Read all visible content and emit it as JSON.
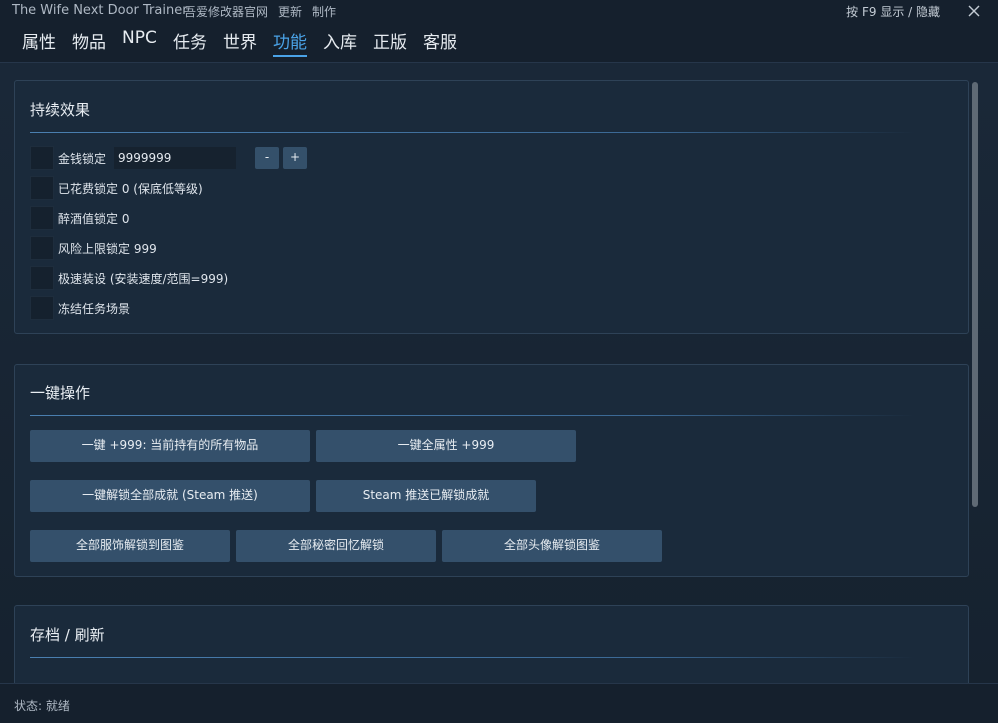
{
  "window": {
    "title": "The Wife Next Door Trainer",
    "links": [
      "吾爱修改器官网",
      "更新",
      "制作"
    ],
    "hint": "按 F9 显示 / 隐藏"
  },
  "tabs": [
    {
      "label": "属性",
      "active": false
    },
    {
      "label": "物品",
      "active": false
    },
    {
      "label": "NPC",
      "active": false
    },
    {
      "label": "任务",
      "active": false
    },
    {
      "label": "世界",
      "active": false
    },
    {
      "label": "功能",
      "active": true
    },
    {
      "label": "入库",
      "active": false
    },
    {
      "label": "正版",
      "active": false
    },
    {
      "label": "客服",
      "active": false
    }
  ],
  "sections": {
    "persistent": {
      "title": "持续效果",
      "money": {
        "label": "金钱锁定",
        "value": "9999999",
        "minus": "-",
        "plus": "+"
      },
      "items": [
        "已花费锁定 0 (保底低等级)",
        "醉酒值锁定 0",
        "风险上限锁定 999",
        "极速装设 (安装速度/范围=999)",
        "冻结任务场景"
      ]
    },
    "oneclick": {
      "title": "一键操作",
      "buttons": [
        "一键 +999: 当前持有的所有物品",
        "一键全属性 +999",
        "一键解锁全部成就 (Steam 推送)",
        "Steam 推送已解锁成就",
        "全部服饰解锁到图鉴",
        "全部秘密回忆解锁",
        "全部头像解锁图鉴"
      ]
    },
    "save": {
      "title": "存档 / 刷新"
    }
  },
  "status": {
    "text": "状态: 就绪"
  },
  "colors": {
    "accent": "#4aa3e8",
    "button": "#34506b",
    "background": "#14202e"
  }
}
